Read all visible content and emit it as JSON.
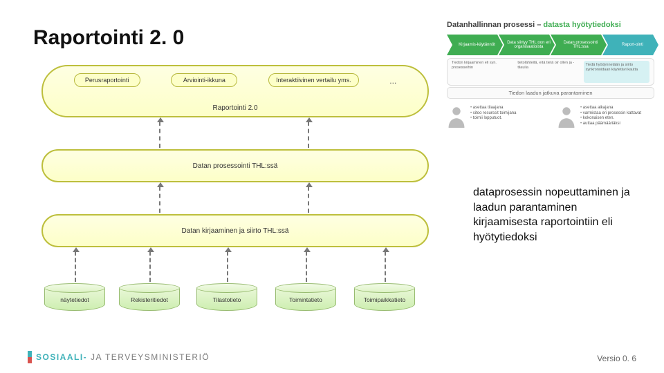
{
  "title": "Raportointi 2. 0",
  "diagram": {
    "r2label": "Raportointi 2.0",
    "topNodes": [
      "Perusraportointi",
      "Arviointi-ikkuna",
      "Interaktiivinen vertailu yms.",
      "..."
    ],
    "mid": "Datan prosessointi THL:ssä",
    "low": "Datan kirjaaminen ja siirto THL:ssä",
    "cylinders": [
      "näytetiedot",
      "Rekisteritiedot",
      "Tilastotieto",
      "Toimintatieto",
      "Toimipaikkatieto"
    ]
  },
  "inset": {
    "title_grey": "Datanhallinnan prosessi – ",
    "title_green": "datasta hyötytiedoksi",
    "chevrons": [
      {
        "cls": "g",
        "label": "Kirjaamis-käytännöt"
      },
      {
        "cls": "g",
        "label": "Data siirtyy THL:oon eri organisaatioista"
      },
      {
        "cls": "g",
        "label": "Datan prosessointi THL:ssa"
      },
      {
        "cls": "t",
        "label": "Raport-ointi"
      }
    ],
    "subcells": [
      {
        "cls": "",
        "text": "Tiedon kirjaaminen eli syn. prosesseihin"
      },
      {
        "cls": "",
        "text": "tietolähteitä, eitä tietä oir ollen ja -tilauila"
      },
      {
        "cls": "bluebg",
        "text": "Tiedä hyödynnetään ja siirto synkronoidaan käytetävi kautta"
      }
    ],
    "improveBar": "Tiedon laadun jatkuva parantaminen",
    "persons": [
      {
        "items": [
          "asettaa tilaajana",
          "sitoo resurssit toimijana",
          "toimii lopputuot."
        ]
      },
      {
        "items": [
          "asettaa aikajana",
          "varmistaa eri prosessin kattavat",
          "kokonaisen eten.",
          "auttaa päämääriäksi"
        ]
      }
    ]
  },
  "rightnote": "dataprosessin nopeuttaminen ja laadun parantaminen kirjaamisesta raportointiin eli hyötytiedoksi",
  "footer": {
    "logo_bold": "SOSIAALI-",
    "logo_mid": " JA ",
    "logo_rest": "TERVEYSMINISTERIÖ",
    "version": "Versio 0. 6"
  }
}
